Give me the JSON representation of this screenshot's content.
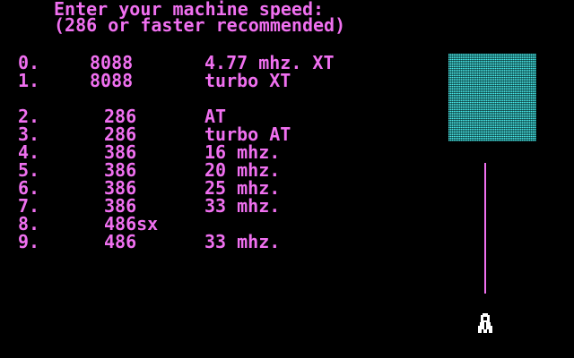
{
  "prompt": {
    "line1": "Enter your machine speed:",
    "line2": "(286 or faster recommended)"
  },
  "options": [
    {
      "num": "0.",
      "cpu": "8088",
      "desc": "4.77 mhz. XT"
    },
    {
      "num": "1.",
      "cpu": "8088",
      "desc": "turbo XT"
    },
    {
      "num": "2.",
      "cpu": "286",
      "desc": "AT"
    },
    {
      "num": "3.",
      "cpu": "286",
      "desc": "turbo AT"
    },
    {
      "num": "4.",
      "cpu": "386",
      "desc": "16 mhz."
    },
    {
      "num": "5.",
      "cpu": "386",
      "desc": "20 mhz."
    },
    {
      "num": "6.",
      "cpu": "386",
      "desc": "25 mhz."
    },
    {
      "num": "7.",
      "cpu": "386",
      "desc": "33 mhz."
    },
    {
      "num": "8.",
      "cpu": "486sx",
      "desc": ""
    },
    {
      "num": "9.",
      "cpu": "486",
      "desc": "33 mhz."
    }
  ],
  "colors": {
    "text": "#f070f0",
    "background": "#000000",
    "preview": "#1a9a9a"
  },
  "icons": {
    "ship": "ship-icon"
  }
}
